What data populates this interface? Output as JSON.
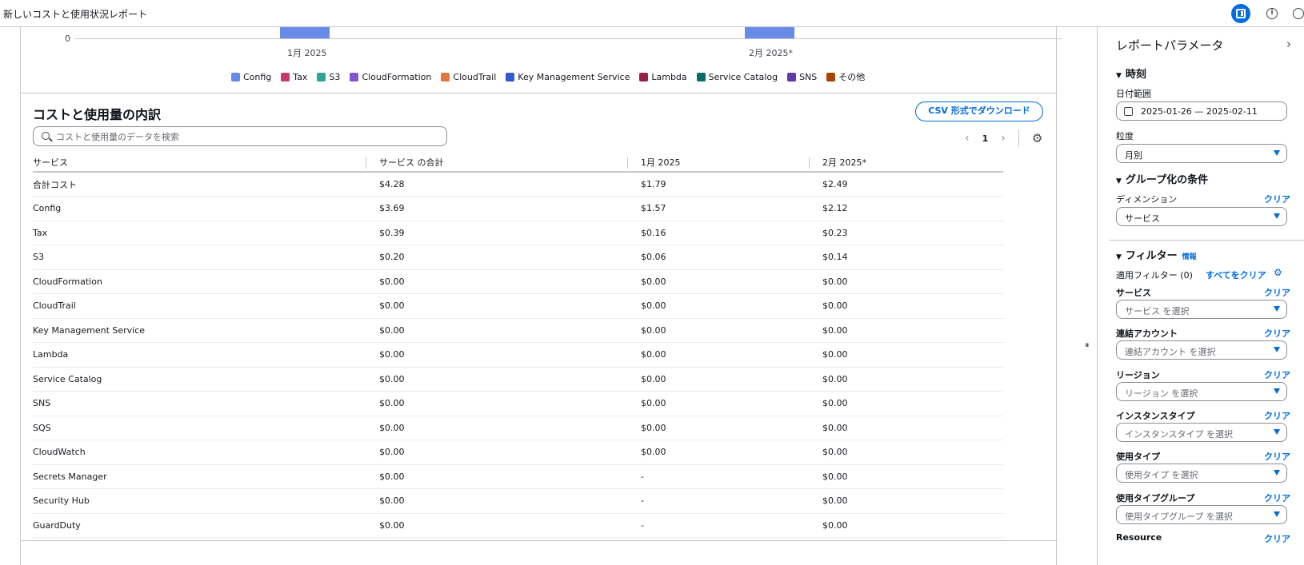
{
  "header": {
    "title": "新しいコストと使用状況レポート"
  },
  "chart_data": {
    "type": "bar",
    "categories": [
      "1月 2025",
      "2月 2025*"
    ],
    "ytick_visible": "0",
    "series": [
      {
        "name": "Config",
        "color": "#688ae8"
      },
      {
        "name": "Tax",
        "color": "#c33d69"
      },
      {
        "name": "S3",
        "color": "#2ea597"
      },
      {
        "name": "CloudFormation",
        "color": "#8456ce"
      },
      {
        "name": "CloudTrail",
        "color": "#e07941"
      },
      {
        "name": "Key Management Service",
        "color": "#3759ce"
      },
      {
        "name": "Lambda",
        "color": "#962249"
      },
      {
        "name": "Service Catalog",
        "color": "#096f64"
      },
      {
        "name": "SNS",
        "color": "#6237a7"
      },
      {
        "name": "その他",
        "color": "#a84401"
      }
    ]
  },
  "breakdown": {
    "title": "コストと使用量の内訳",
    "csv_button": "CSV 形式でダウンロード",
    "search_placeholder": "コストと使用量のデータを検索",
    "page": "1",
    "columns": [
      "サービス",
      "サービス の合計",
      "1月 2025",
      "2月 2025*"
    ],
    "rows": [
      [
        "合計コスト",
        "$4.28",
        "$1.79",
        "$2.49"
      ],
      [
        "Config",
        "$3.69",
        "$1.57",
        "$2.12"
      ],
      [
        "Tax",
        "$0.39",
        "$0.16",
        "$0.23"
      ],
      [
        "S3",
        "$0.20",
        "$0.06",
        "$0.14"
      ],
      [
        "CloudFormation",
        "$0.00",
        "$0.00",
        "$0.00"
      ],
      [
        "CloudTrail",
        "$0.00",
        "$0.00",
        "$0.00"
      ],
      [
        "Key Management Service",
        "$0.00",
        "$0.00",
        "$0.00"
      ],
      [
        "Lambda",
        "$0.00",
        "$0.00",
        "$0.00"
      ],
      [
        "Service Catalog",
        "$0.00",
        "$0.00",
        "$0.00"
      ],
      [
        "SNS",
        "$0.00",
        "$0.00",
        "$0.00"
      ],
      [
        "SQS",
        "$0.00",
        "$0.00",
        "$0.00"
      ],
      [
        "CloudWatch",
        "$0.00",
        "$0.00",
        "$0.00"
      ],
      [
        "Secrets Manager",
        "$0.00",
        "-",
        "$0.00"
      ],
      [
        "Security Hub",
        "$0.00",
        "-",
        "$0.00"
      ],
      [
        "GuardDuty",
        "$0.00",
        "-",
        "$0.00"
      ]
    ]
  },
  "panel": {
    "title": "レポートパラメータ",
    "time_section": "時刻",
    "date_range_label": "日付範囲",
    "date_range_value": "2025-01-26 — 2025-02-11",
    "granularity_label": "粒度",
    "granularity_value": "月別",
    "group_section": "グループ化の条件",
    "dimension_label": "ディメンション",
    "dimension_value": "サービス",
    "clear": "クリア",
    "filter_section": "フィルター",
    "info": "情報",
    "applied_filters": "適用フィルター (0)",
    "clear_all": "すべてをクリア",
    "filters": [
      {
        "label": "サービス",
        "placeholder": "サービス を選択"
      },
      {
        "label": "連結アカウント",
        "placeholder": "連結アカウント を選択"
      },
      {
        "label": "リージョン",
        "placeholder": "リージョン を選択"
      },
      {
        "label": "インスタンスタイプ",
        "placeholder": "インスタンスタイプ を選択"
      },
      {
        "label": "使用タイプ",
        "placeholder": "使用タイプ を選択"
      },
      {
        "label": "使用タイプグループ",
        "placeholder": "使用タイプグループ を選択"
      }
    ],
    "resource_label": "Resource"
  }
}
